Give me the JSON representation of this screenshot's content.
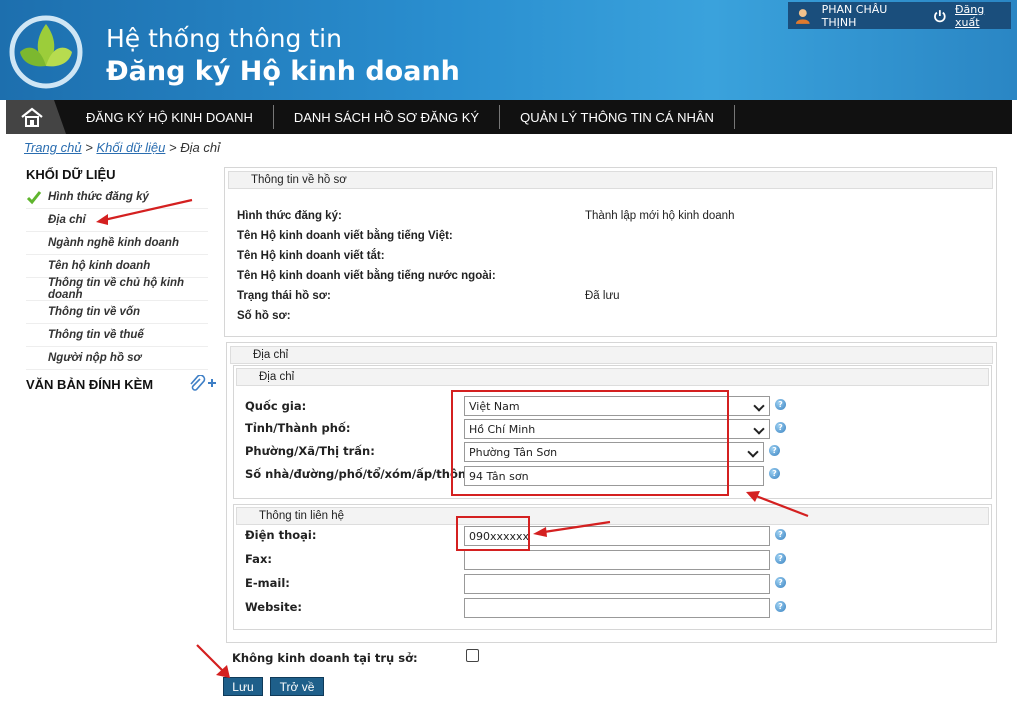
{
  "header": {
    "title_line1": "Hệ thống thông tin",
    "title_line2": "Đăng ký Hộ kinh doanh",
    "user_name": "PHAN CHÂU THỊNH",
    "logout_label": "Đăng xuất"
  },
  "nav": {
    "items": [
      {
        "label": "ĐĂNG KÝ HỘ KINH DOANH"
      },
      {
        "label": "DANH SÁCH HỒ SƠ ĐĂNG KÝ"
      },
      {
        "label": "QUẢN LÝ THÔNG TIN CÁ NHÂN"
      }
    ]
  },
  "breadcrumb": {
    "home": "Trang chủ",
    "sep": ">",
    "level1": "Khối dữ liệu",
    "current": "Địa chỉ"
  },
  "sidebar": {
    "title": "KHỐI DỮ LIỆU",
    "items": [
      {
        "label": "Hình thức đăng ký"
      },
      {
        "label": "Địa chỉ"
      },
      {
        "label": "Ngành nghề kinh doanh"
      },
      {
        "label": "Tên hộ kinh doanh"
      },
      {
        "label": "Thông tin về chủ hộ kinh doanh"
      },
      {
        "label": "Thông tin về vốn"
      },
      {
        "label": "Thông tin về thuế"
      },
      {
        "label": "Người nộp hồ sơ"
      }
    ],
    "attachments_title": "VĂN BẢN ĐÍNH KÈM"
  },
  "profile": {
    "header": "Thông tin về hồ sơ",
    "rows": [
      {
        "label": "Hình thức đăng ký:",
        "value": "Thành lập mới hộ kinh doanh"
      },
      {
        "label": "Tên Hộ kinh doanh viết bằng tiếng Việt:",
        "value": ""
      },
      {
        "label": "Tên Hộ kinh doanh viết tắt:",
        "value": ""
      },
      {
        "label": "Tên Hộ kinh doanh viết bằng tiếng nước ngoài:",
        "value": ""
      },
      {
        "label": "Trạng thái hồ sơ:",
        "value": "Đã lưu"
      },
      {
        "label": "Số hồ sơ:",
        "value": ""
      }
    ]
  },
  "address": {
    "outer_header": "Địa chỉ",
    "inner_header": "Địa chỉ",
    "country_label": "Quốc gia:",
    "country_value": "Việt Nam",
    "province_label": "Tỉnh/Thành phố:",
    "province_value": "Hồ Chí Minh",
    "ward_label": "Phường/Xã/Thị trấn:",
    "ward_value": "Phường Tân Sơn",
    "street_label": "Số nhà/đường/phố/tổ/xóm/ấp/thôn:",
    "street_value": "94 Tân sơn"
  },
  "contact": {
    "header": "Thông tin liên hệ",
    "phone_label": "Điện thoại:",
    "phone_value": "090xxxxxx",
    "fax_label": "Fax:",
    "fax_value": "",
    "email_label": "E-mail:",
    "email_value": "",
    "website_label": "Website:",
    "website_value": ""
  },
  "footer": {
    "no_business_label": "Không kinh doanh tại trụ sở:",
    "save_label": "Lưu",
    "back_label": "Trở về"
  },
  "colors": {
    "header_blue": "#2a8fd0",
    "nav_black": "#111111",
    "button_blue": "#1e5f8a",
    "annotation_red": "#d42020",
    "link_blue": "#2a6db0"
  }
}
